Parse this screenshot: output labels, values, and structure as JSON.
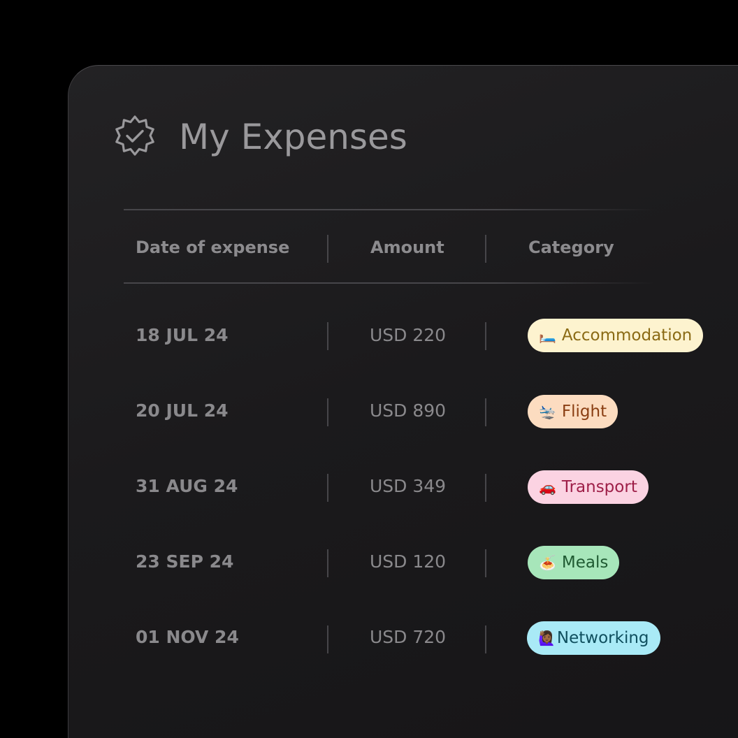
{
  "header": {
    "title": "My Expenses",
    "icon": "verified-badge-icon"
  },
  "table": {
    "columns": [
      "Date of expense",
      "Amount",
      "Category"
    ],
    "rows": [
      {
        "date": "18 JUL 24",
        "amount": "USD 220",
        "category": "Accommodation",
        "emoji": "🛏️",
        "bg": "#fdf3cf",
        "fg": "#8a6a14"
      },
      {
        "date": "20 JUL 24",
        "amount": "USD 890",
        "category": "Flight",
        "emoji": "🛬",
        "bg": "#fcdcc0",
        "fg": "#8a3e12"
      },
      {
        "date": "31 AUG 24",
        "amount": "USD 349",
        "category": "Transport",
        "emoji": "🚗",
        "bg": "#fbd3e2",
        "fg": "#9e1f48"
      },
      {
        "date": "23 SEP 24",
        "amount": "USD 120",
        "category": "Meals",
        "emoji": "🍝",
        "bg": "#a7e6ba",
        "fg": "#1f5a32"
      },
      {
        "date": "01 NOV 24",
        "amount": "USD 720",
        "category": "Networking",
        "emoji": "🙋🏾‍♀️",
        "bg": "#a9eaf6",
        "fg": "#0f4f5e"
      }
    ]
  },
  "colors": {
    "background": "#000000",
    "card": "#1e1d1f",
    "text_muted": "#8a898c"
  }
}
